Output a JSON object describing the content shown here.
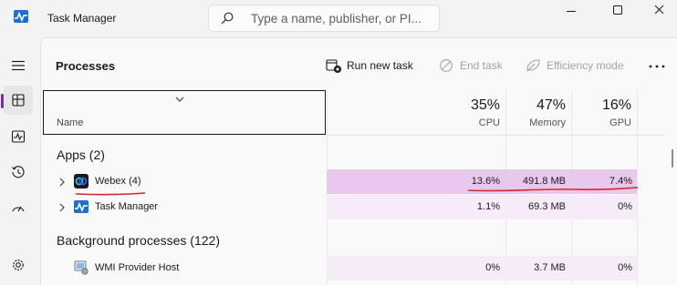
{
  "window": {
    "title": "Task Manager",
    "search_placeholder": "Type a name, publisher, or PI..."
  },
  "nav": {
    "items": [
      "hamburger-menu",
      "processes",
      "performance",
      "app-history",
      "startup-apps",
      "settings"
    ]
  },
  "toolbar": {
    "page_title": "Processes",
    "run_new_task": "Run new task",
    "end_task": "End task",
    "efficiency_mode": "Efficiency mode"
  },
  "columns": {
    "name": "Name",
    "cpu": {
      "pct": "35%",
      "label": "CPU"
    },
    "memory": {
      "pct": "47%",
      "label": "Memory"
    },
    "gpu": {
      "pct": "16%",
      "label": "GPU"
    }
  },
  "groups": {
    "apps": "Apps (2)",
    "background": "Background processes (122)"
  },
  "rows": [
    {
      "name": "Webex (4)",
      "cpu": "13.6%",
      "memory": "491.8 MB",
      "gpu": "7.4%"
    },
    {
      "name": "Task Manager",
      "cpu": "1.1%",
      "memory": "69.3 MB",
      "gpu": "0%"
    },
    {
      "name": "WMI Provider Host",
      "cpu": "0%",
      "memory": "3.7 MB",
      "gpu": "0%"
    }
  ],
  "colors": {
    "heat_high": "#e8c8ec",
    "heat_low": "#f6ecf8",
    "accent": "#7b2ea6",
    "annotation_red": "#d9262a"
  }
}
